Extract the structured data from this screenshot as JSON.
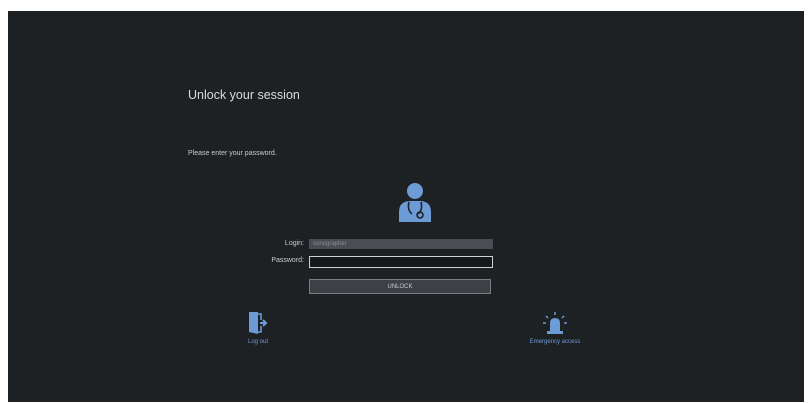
{
  "screen": {
    "title": "Unlock your session",
    "subtitle": "Please enter your password."
  },
  "form": {
    "login_label": "Login:",
    "login_value": "sonographer",
    "password_label": "Password:",
    "password_value": "",
    "unlock_label": "UNLOCK"
  },
  "actions": {
    "logout_label": "Log out",
    "emergency_label": "Emergency access"
  },
  "icons": {
    "avatar": "doctor-user-icon",
    "logout": "logout-door-icon",
    "emergency": "emergency-siren-icon"
  },
  "colors": {
    "background": "#1e2124",
    "accent": "#6c9bd6"
  }
}
